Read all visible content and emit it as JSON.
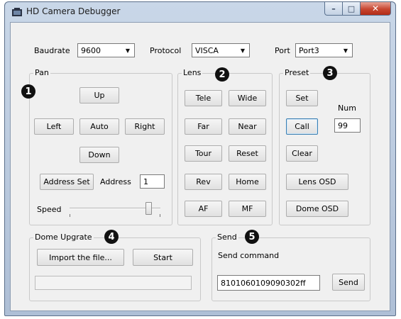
{
  "window": {
    "title": "HD Camera Debugger",
    "app_icon": "camera-app-icon"
  },
  "caption": {
    "minimize": "–",
    "maximize": "□",
    "close": "✕"
  },
  "top": {
    "baudrate_label": "Baudrate",
    "baudrate_value": "9600",
    "protocol_label": "Protocol",
    "protocol_value": "VISCA",
    "port_label": "Port",
    "port_value": "Port3"
  },
  "pan": {
    "title": "Pan",
    "badge": "1",
    "up": "Up",
    "left": "Left",
    "auto": "Auto",
    "right": "Right",
    "down": "Down",
    "address_set": "Address Set",
    "address_label": "Address",
    "address_value": "1",
    "speed_label": "Speed",
    "speed_level": 1.0
  },
  "lens": {
    "title": "Lens",
    "badge": "2",
    "tele": "Tele",
    "wide": "Wide",
    "far": "Far",
    "near": "Near",
    "tour": "Tour",
    "reset": "Reset",
    "rev": "Rev",
    "home": "Home",
    "af": "AF",
    "mf": "MF"
  },
  "preset": {
    "title": "Preset",
    "badge": "3",
    "set": "Set",
    "num_label": "Num",
    "call": "Call",
    "num_value": "99",
    "clear": "Clear",
    "lens_osd": "Lens OSD",
    "dome_osd": "Dome OSD"
  },
  "upgrade": {
    "title": "Dome Upgrate",
    "badge": "4",
    "import": "Import the file...",
    "start": "Start",
    "progress": 0
  },
  "send": {
    "title": "Send",
    "badge": "5",
    "label": "Send command",
    "command_value": "8101060109090302ff",
    "send_button": "Send"
  },
  "colors": {
    "titlebar": "#c9d7e8",
    "close": "#c74630",
    "client": "#f0f0f0"
  }
}
